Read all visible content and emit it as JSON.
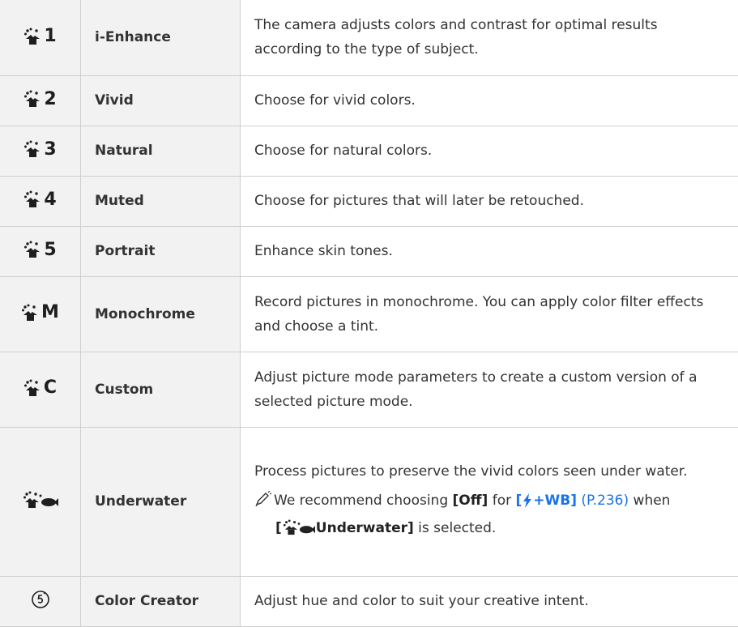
{
  "rows": [
    {
      "icon": "picture-mode-icon",
      "suffix": "1",
      "name": "i-Enhance",
      "desc": "The camera adjusts colors and contrast for optimal results according to the type of subject."
    },
    {
      "icon": "picture-mode-icon",
      "suffix": "2",
      "name": "Vivid",
      "desc": "Choose for vivid colors."
    },
    {
      "icon": "picture-mode-icon",
      "suffix": "3",
      "name": "Natural",
      "desc": "Choose for natural colors."
    },
    {
      "icon": "picture-mode-icon",
      "suffix": "4",
      "name": "Muted",
      "desc": "Choose for pictures that will later be retouched."
    },
    {
      "icon": "picture-mode-icon",
      "suffix": "5",
      "name": "Portrait",
      "desc": "Enhance skin tones."
    },
    {
      "icon": "picture-mode-icon",
      "suffix": "M",
      "name": "Monochrome",
      "desc": "Record pictures in monochrome. You can apply color filter effects and choose a tint."
    },
    {
      "icon": "picture-mode-icon",
      "suffix": "C",
      "name": "Custom",
      "desc": "Adjust picture mode parameters to create a custom version of a selected picture mode."
    },
    {
      "icon": "underwater-mode-icon",
      "name": "Underwater",
      "desc": "Process pictures to preserve the vivid colors seen under water.",
      "tip": {
        "icon": "pencil-tip-icon",
        "pre": "We recommend choosing",
        "off": "[Off]",
        "for": "for",
        "flash_open": "[",
        "flash_icon": "flash-icon",
        "flash_rest": "+WB]",
        "ref": "(P.236)",
        "when": "when",
        "uw_open": "[",
        "uw_icon": "underwater-mode-icon",
        "uw_rest": "Underwater]",
        "selected": "is selected."
      }
    },
    {
      "icon": "color-creator-dial-icon",
      "name": "Color Creator",
      "desc": "Adjust hue and color to suit your creative intent."
    }
  ],
  "colors": {
    "link": "#1a73e8",
    "cell_bg": "#f2f2f2",
    "border": "#cfcfcf"
  }
}
